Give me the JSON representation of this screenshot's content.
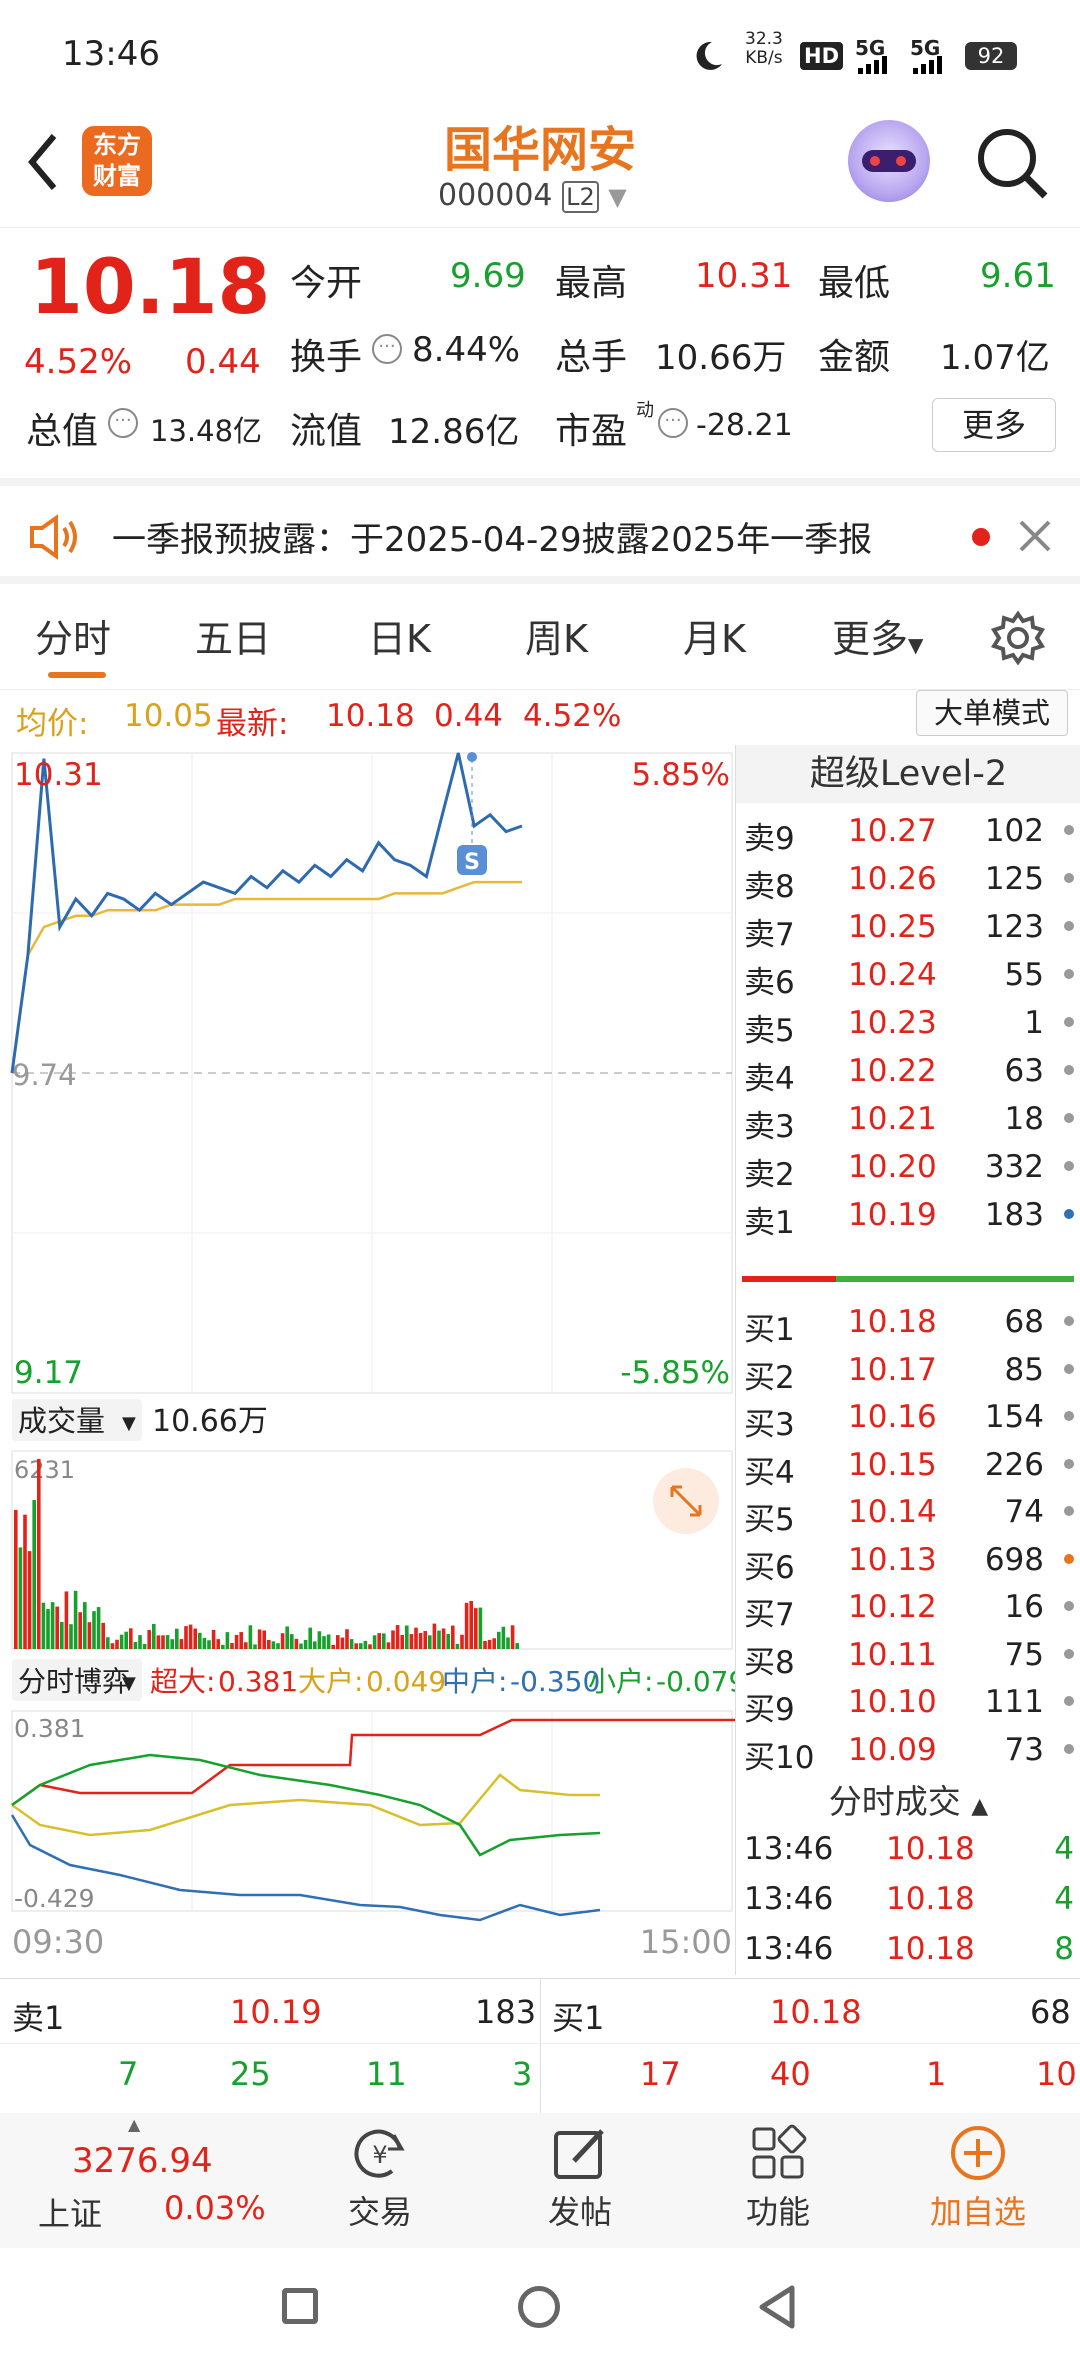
{
  "status": {
    "time": "13:46",
    "speed": "32.3",
    "speed_unit": "KB/s",
    "hd": "HD",
    "net1": "5G",
    "net2": "5G",
    "battery": "92"
  },
  "header": {
    "logo": "东方财富",
    "title": "国华网安",
    "code": "000004",
    "level": "L2"
  },
  "quote": {
    "price": "10.18",
    "pct": "4.52%",
    "chg": "0.44",
    "r1": [
      {
        "k": "今开",
        "v": "9.69"
      },
      {
        "k": "最高",
        "v": "10.31"
      },
      {
        "k": "最低",
        "v": "9.61"
      }
    ],
    "r2": [
      {
        "k": "换手",
        "v": "8.44%"
      },
      {
        "k": "总手",
        "v": "10.66万"
      },
      {
        "k": "金额",
        "v": "1.07亿"
      }
    ],
    "r3": [
      {
        "k": "总值",
        "v": "13.48亿"
      },
      {
        "k": "流值",
        "v": "12.86亿"
      },
      {
        "k": "市盈",
        "sup": "动",
        "v": "-28.21"
      }
    ],
    "more": "更多"
  },
  "notice": {
    "text": "一季报预披露：于2025-04-29披露2025年一季报"
  },
  "tabs": [
    "分时",
    "五日",
    "日K",
    "周K",
    "月K",
    "更多"
  ],
  "summary": {
    "avg_label": "均价:",
    "avg": "10.05",
    "new_label": "最新:",
    "new": "10.18",
    "chg": "0.44",
    "pct": "4.52%",
    "mode": "大单模式"
  },
  "chart": {
    "ytop": "10.31",
    "ytop_pct": "5.85%",
    "ymid": "9.74",
    "ybot": "9.17",
    "ybot_pct": "-5.85%",
    "vol_label": "成交量",
    "vol": "10.66万",
    "vol_max": "6231",
    "game_label": "分时博弈",
    "game": [
      {
        "k": "超大:",
        "v": "0.381"
      },
      {
        "k": "大户:",
        "v": "0.049"
      },
      {
        "k": "中户:",
        "v": "-0.350"
      },
      {
        "k": "小户:",
        "v": "-0.079"
      }
    ],
    "flow_max": "0.381",
    "flow_min": "-0.429",
    "t_start": "09:30",
    "t_end": "15:00",
    "marker": "S"
  },
  "chart_data": {
    "type": "line",
    "price": [
      9.74,
      9.95,
      10.3,
      10.0,
      10.05,
      10.02,
      10.06,
      10.05,
      10.03,
      10.06,
      10.04,
      10.06,
      10.08,
      10.07,
      10.06,
      10.09,
      10.07,
      10.1,
      10.08,
      10.11,
      10.09,
      10.12,
      10.1,
      10.15,
      10.12,
      10.11,
      10.09,
      10.2,
      10.31,
      10.18,
      10.2,
      10.17,
      10.18
    ],
    "avg": [
      9.74,
      9.95,
      10.0,
      10.01,
      10.02,
      10.02,
      10.03,
      10.03,
      10.03,
      10.03,
      10.04,
      10.04,
      10.04,
      10.04,
      10.05,
      10.05,
      10.05,
      10.05,
      10.05,
      10.05,
      10.05,
      10.05,
      10.05,
      10.05,
      10.06,
      10.06,
      10.06,
      10.06,
      10.07,
      10.08,
      10.08,
      10.08,
      10.08
    ]
  },
  "book": {
    "title": "超级Level-2",
    "asks": [
      {
        "l": "卖9",
        "p": "10.27",
        "q": "102"
      },
      {
        "l": "卖8",
        "p": "10.26",
        "q": "125"
      },
      {
        "l": "卖7",
        "p": "10.25",
        "q": "123"
      },
      {
        "l": "卖6",
        "p": "10.24",
        "q": "55"
      },
      {
        "l": "卖5",
        "p": "10.23",
        "q": "1"
      },
      {
        "l": "卖4",
        "p": "10.22",
        "q": "63"
      },
      {
        "l": "卖3",
        "p": "10.21",
        "q": "18"
      },
      {
        "l": "卖2",
        "p": "10.20",
        "q": "332"
      },
      {
        "l": "卖1",
        "p": "10.19",
        "q": "183"
      }
    ],
    "bids": [
      {
        "l": "买1",
        "p": "10.18",
        "q": "68"
      },
      {
        "l": "买2",
        "p": "10.17",
        "q": "85"
      },
      {
        "l": "买3",
        "p": "10.16",
        "q": "154"
      },
      {
        "l": "买4",
        "p": "10.15",
        "q": "226"
      },
      {
        "l": "买5",
        "p": "10.14",
        "q": "74"
      },
      {
        "l": "买6",
        "p": "10.13",
        "q": "698"
      },
      {
        "l": "买7",
        "p": "10.12",
        "q": "16"
      },
      {
        "l": "买8",
        "p": "10.11",
        "q": "75"
      },
      {
        "l": "买9",
        "p": "10.10",
        "q": "111"
      },
      {
        "l": "买10",
        "p": "10.09",
        "q": "73"
      }
    ],
    "trade_title": "分时成交",
    "trades": [
      {
        "t": "13:46",
        "p": "10.18",
        "q": "4"
      },
      {
        "t": "13:46",
        "p": "10.18",
        "q": "4"
      },
      {
        "t": "13:46",
        "p": "10.18",
        "q": "8"
      }
    ]
  },
  "foot": {
    "ask_l": "卖1",
    "ask_p": "10.19",
    "ask_q": "183",
    "bid_l": "买1",
    "bid_p": "10.18",
    "bid_q": "68",
    "a_nums": [
      "7",
      "25",
      "11",
      "3"
    ],
    "b_nums": [
      "17",
      "40",
      "1",
      "10"
    ]
  },
  "nav": {
    "index_val": "3276.94",
    "index_name": "上证",
    "index_pct": "0.03%",
    "items": [
      "交易",
      "发帖",
      "功能",
      "加自选"
    ]
  }
}
